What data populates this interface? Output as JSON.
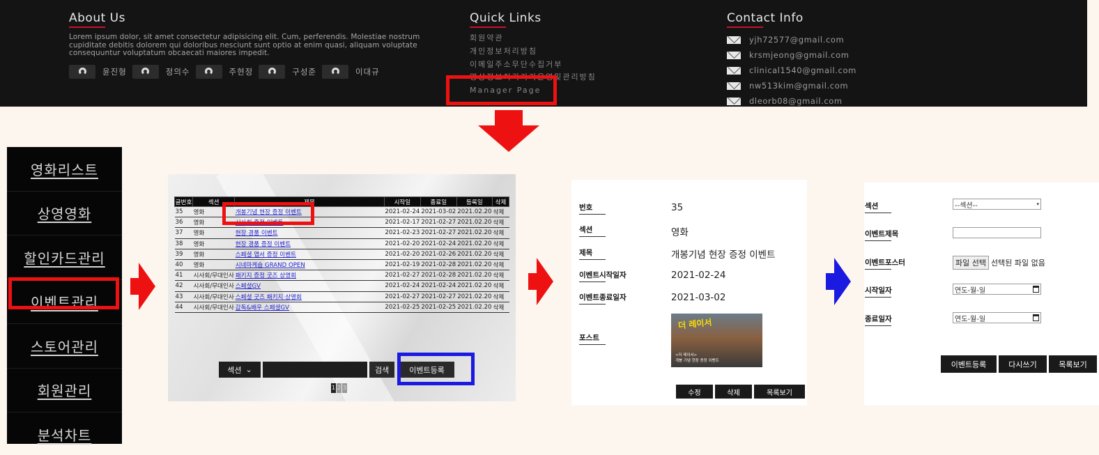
{
  "footer": {
    "about": {
      "title": "About Us",
      "text": "Lorem ipsum dolor, sit amet consectetur adipisicing elit. Cum, perferendis. Molestiae nostrum cupiditate debitis dolorem qui doloribus nesciunt sunt optio at enim quasi, aliquam voluptate consequuntur voluptatum obcaecati maiores impedit.",
      "members": [
        "윤진형",
        "정의수",
        "주현정",
        "구성준",
        "이대규"
      ]
    },
    "quick_links": {
      "title": "Quick Links",
      "items": [
        "회원약관",
        "개인정보처리방침",
        "이메일주소무단수집거부",
        "영상정보처리기기운영및관리방침",
        "Manager Page"
      ]
    },
    "contact": {
      "title": "Contact Info",
      "emails": [
        "yjh72577@gmail.com",
        "krsmjeong@gmail.com",
        "clinical1540@gmail.com",
        "nw513kim@gmail.com",
        "dleorb08@gmail.com"
      ]
    }
  },
  "sidebar": {
    "items": [
      "영화리스트",
      "상영영화",
      "할인카드관리",
      "이벤트관리",
      "스토어관리",
      "회원관리",
      "분석차트"
    ]
  },
  "event_list": {
    "headers": [
      "글번호",
      "섹션",
      "제목",
      "시작일",
      "종료일",
      "등록일",
      "삭제"
    ],
    "rows": [
      [
        "35",
        "영화",
        "개봉기념 현장 증정 이벤트",
        "2021-02-24",
        "2021-03-02",
        "2021.02.20",
        "삭제"
      ],
      [
        "36",
        "영화",
        "시사회 증정 이벤트",
        "2021-02-17",
        "2021-02-27",
        "2021.02.20",
        "삭제"
      ],
      [
        "37",
        "영화",
        "현장 경품 이벤트",
        "2021-02-23",
        "2021-02-27",
        "2021.02.20",
        "삭제"
      ],
      [
        "38",
        "영화",
        "현장 경품 증정 이벤트",
        "2021-02-20",
        "2021-02-24",
        "2021.02.20",
        "삭제"
      ],
      [
        "39",
        "영화",
        "스페셜 엽서 증정 이벤트",
        "2021-02-20",
        "2021-02-26",
        "2021.02.20",
        "삭제"
      ],
      [
        "40",
        "영화",
        "시네마케숍 GRAND OPEN",
        "2021-02-19",
        "2021-02-28",
        "2021.02.20",
        "삭제"
      ],
      [
        "41",
        "시사회/무대인사",
        "패키지 증정 굿즈 상영회",
        "2021-02-27",
        "2021-02-28",
        "2021.02.20",
        "삭제"
      ],
      [
        "42",
        "시사회/무대인사",
        "스페셜GV",
        "2021-02-24",
        "2021-02-24",
        "2021.02.20",
        "삭제"
      ],
      [
        "43",
        "시사회/무대인사",
        "스페셜 굿즈 패키지 상영회",
        "2021-02-27",
        "2021-02-27",
        "2021.02.20",
        "삭제"
      ],
      [
        "44",
        "시사회/무대인사",
        "감독&배우 스페셜GV",
        "2021-02-25",
        "2021-02-25",
        "2021.02.20",
        "삭제"
      ]
    ],
    "section_select": "섹션",
    "search_label": "검색",
    "register_label": "이벤트등록",
    "pages": [
      "1",
      "2",
      "3"
    ]
  },
  "detail": {
    "labels": [
      "번호",
      "섹션",
      "제목",
      "이벤트시작일자",
      "이벤트종료일자",
      "포스트"
    ],
    "values": [
      "35",
      "영화",
      "개봉기념 현장 증정 이벤트",
      "2021-02-24",
      "2021-03-02"
    ],
    "poster_title": "더 레이서",
    "poster_sub": "<더 레이서>\n개봉 기념 현장 증정 이벤트",
    "buttons": [
      "수정",
      "삭제",
      "목록보기"
    ]
  },
  "form": {
    "labels": [
      "섹션",
      "이벤트제목",
      "이벤트포스터",
      "시작일자",
      "종료일자"
    ],
    "section_select": "--섹션--",
    "file_button": "파일 선택",
    "file_status": "선택된 파일 없음",
    "date_placeholder": "연도-월-일",
    "buttons": [
      "이벤트등록",
      "다시쓰기",
      "목록보기"
    ]
  },
  "colors": {
    "highlight_red": "#ee1111",
    "highlight_blue": "#1a1ae0",
    "arrow_red": "#ee1111",
    "arrow_blue": "#1a1ae0"
  }
}
